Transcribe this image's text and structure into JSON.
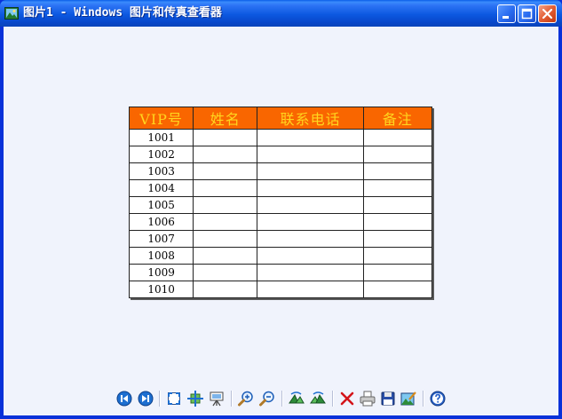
{
  "window": {
    "title": "图片1 - Windows 图片和传真查看器"
  },
  "table": {
    "headers": [
      "VIP号",
      "姓名",
      "联系电话",
      "备注"
    ],
    "rows": [
      [
        "1001",
        "",
        "",
        ""
      ],
      [
        "1002",
        "",
        "",
        ""
      ],
      [
        "1003",
        "",
        "",
        ""
      ],
      [
        "1004",
        "",
        "",
        ""
      ],
      [
        "1005",
        "",
        "",
        ""
      ],
      [
        "1006",
        "",
        "",
        ""
      ],
      [
        "1007",
        "",
        "",
        ""
      ],
      [
        "1008",
        "",
        "",
        ""
      ],
      [
        "1009",
        "",
        "",
        ""
      ],
      [
        "1010",
        "",
        "",
        ""
      ]
    ],
    "colors": {
      "header_bg": "#f96600",
      "header_text": "#ffd51e"
    }
  },
  "toolbar": {
    "icons": [
      "previous-image-icon",
      "next-image-icon",
      "best-fit-icon",
      "actual-size-icon",
      "slideshow-icon",
      "zoom-in-icon",
      "zoom-out-icon",
      "rotate-clockwise-icon",
      "rotate-counterclockwise-icon",
      "delete-icon",
      "print-icon",
      "save-icon",
      "open-for-editing-icon",
      "help-icon"
    ]
  }
}
